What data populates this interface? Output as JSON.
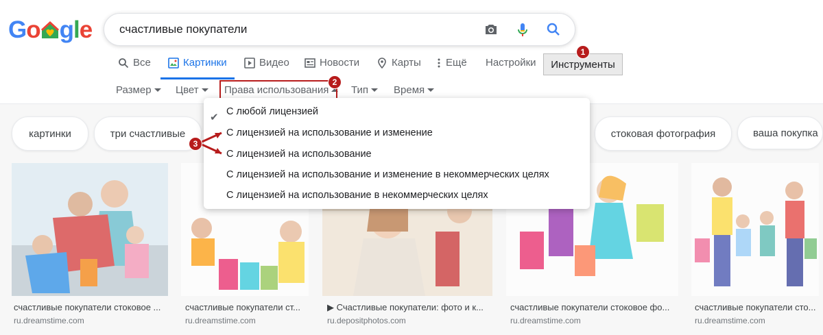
{
  "logo": {
    "text": "Google"
  },
  "search": {
    "query": "счастливые покупатели"
  },
  "tabs": [
    {
      "label": "Все",
      "icon": "search-icon"
    },
    {
      "label": "Картинки",
      "icon": "image-icon"
    },
    {
      "label": "Видео",
      "icon": "video-icon"
    },
    {
      "label": "Новости",
      "icon": "news-icon"
    },
    {
      "label": "Карты",
      "icon": "map-pin-icon"
    },
    {
      "label": "Ещё",
      "icon": "more-vert-icon"
    }
  ],
  "settings_label": "Настройки",
  "tools_label": "Инструменты",
  "filters": {
    "size": "Размер",
    "color": "Цвет",
    "rights": "Права использования",
    "type": "Тип",
    "time": "Время"
  },
  "chips": [
    "картинки",
    "три счастливые",
    "стоковая фотография",
    "ваша покупка"
  ],
  "menu": {
    "items": [
      "С любой лицензией",
      "С лицензией на использование и изменение",
      "С лицензией на использование",
      "С лицензией на использование и изменение в некоммерческих целях",
      "С лицензией на использование в некоммерческих целях"
    ],
    "checked_index": 0
  },
  "results": [
    {
      "caption": "счастливые покупатели стоковое ...",
      "source": "ru.dreamstime.com"
    },
    {
      "caption": "счастливые покупатели ст...",
      "source": "ru.dreamstime.com"
    },
    {
      "caption": "▶ Счастливые покупатели: фото и к...",
      "source": "ru.depositphotos.com"
    },
    {
      "caption": "счастливые покупатели стоковое фо...",
      "source": "ru.dreamstime.com"
    },
    {
      "caption": "счастливые покупатели сто...",
      "source": "ru.dreamstime.com"
    }
  ],
  "annotations": {
    "one": "1",
    "two": "2",
    "three": "3"
  },
  "colors": {
    "accent": "#1a73e8",
    "annotation": "#b71c1c"
  }
}
